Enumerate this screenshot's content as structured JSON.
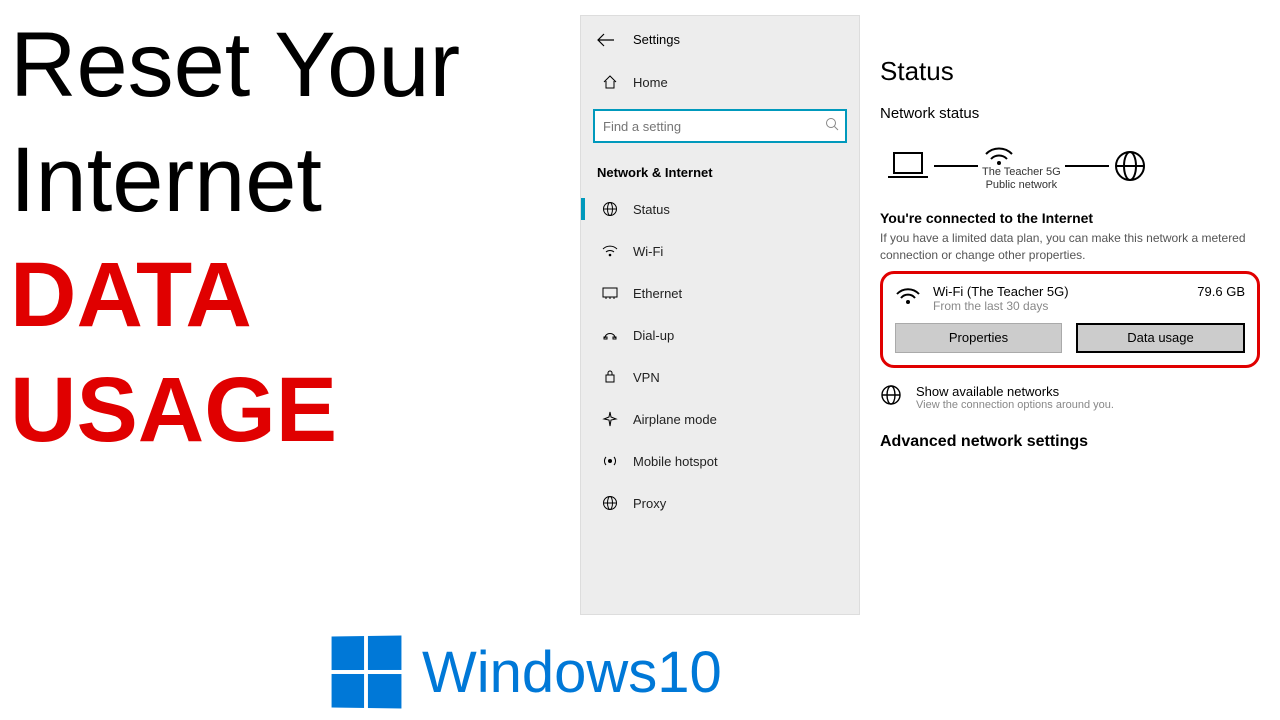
{
  "thumbnail": {
    "line1": "Reset Your",
    "line2": "Internet",
    "line3": "DATA",
    "line4": "USAGE",
    "brand": "Windows10"
  },
  "sidebar": {
    "settings_label": "Settings",
    "home_label": "Home",
    "search_placeholder": "Find a setting",
    "section": "Network & Internet",
    "items": [
      {
        "icon": "status",
        "label": "Status",
        "active": true
      },
      {
        "icon": "wifi",
        "label": "Wi-Fi"
      },
      {
        "icon": "ethernet",
        "label": "Ethernet"
      },
      {
        "icon": "dialup",
        "label": "Dial-up"
      },
      {
        "icon": "vpn",
        "label": "VPN"
      },
      {
        "icon": "airplane",
        "label": "Airplane mode"
      },
      {
        "icon": "hotspot",
        "label": "Mobile hotspot"
      },
      {
        "icon": "proxy",
        "label": "Proxy"
      }
    ]
  },
  "main": {
    "title": "Status",
    "network_status": "Network status",
    "network_name": "The Teacher 5G",
    "network_type": "Public network",
    "connected_heading": "You're connected to the Internet",
    "connected_desc": "If you have a limited data plan, you can make this network a metered connection or change other properties.",
    "card": {
      "name": "Wi-Fi (The Teacher 5G)",
      "period": "From the last 30 days",
      "usage": "79.6 GB",
      "properties_btn": "Properties",
      "data_usage_btn": "Data usage"
    },
    "show_networks_title": "Show available networks",
    "show_networks_desc": "View the connection options around you.",
    "advanced": "Advanced network settings"
  }
}
